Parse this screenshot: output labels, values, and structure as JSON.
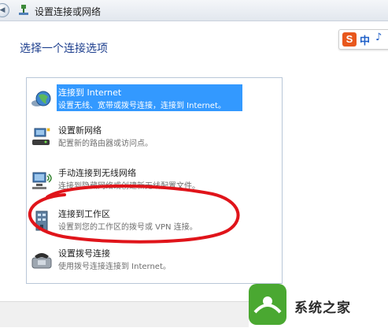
{
  "window": {
    "title": "设置连接或网络"
  },
  "instruction": "选择一个连接选项",
  "ime": {
    "logo": "S",
    "mode": "中",
    "extra": "♪"
  },
  "options": [
    {
      "title": "连接到 Internet",
      "desc": "设置无线、宽带或拨号连接，连接到 Internet。",
      "icon": "globe-network-icon",
      "selected": true
    },
    {
      "title": "设置新网络",
      "desc": "配置新的路由器或访问点。",
      "icon": "new-network-icon",
      "selected": false
    },
    {
      "title": "手动连接到无线网络",
      "desc": "连接到隐藏网络或创建新无线配置文件。",
      "icon": "wireless-computer-icon",
      "selected": false
    },
    {
      "title": "连接到工作区",
      "desc": "设置到您的工作区的拨号或 VPN 连接。",
      "icon": "workplace-icon",
      "selected": false
    },
    {
      "title": "设置拨号连接",
      "desc": "使用拨号连接连接到 Internet。",
      "icon": "dialup-phone-icon",
      "selected": false
    }
  ],
  "watermark": {
    "text": "系统之家"
  },
  "colors": {
    "selection": "#3399ff",
    "instruction": "#1e3f8e",
    "annotation": "#e0141a"
  }
}
